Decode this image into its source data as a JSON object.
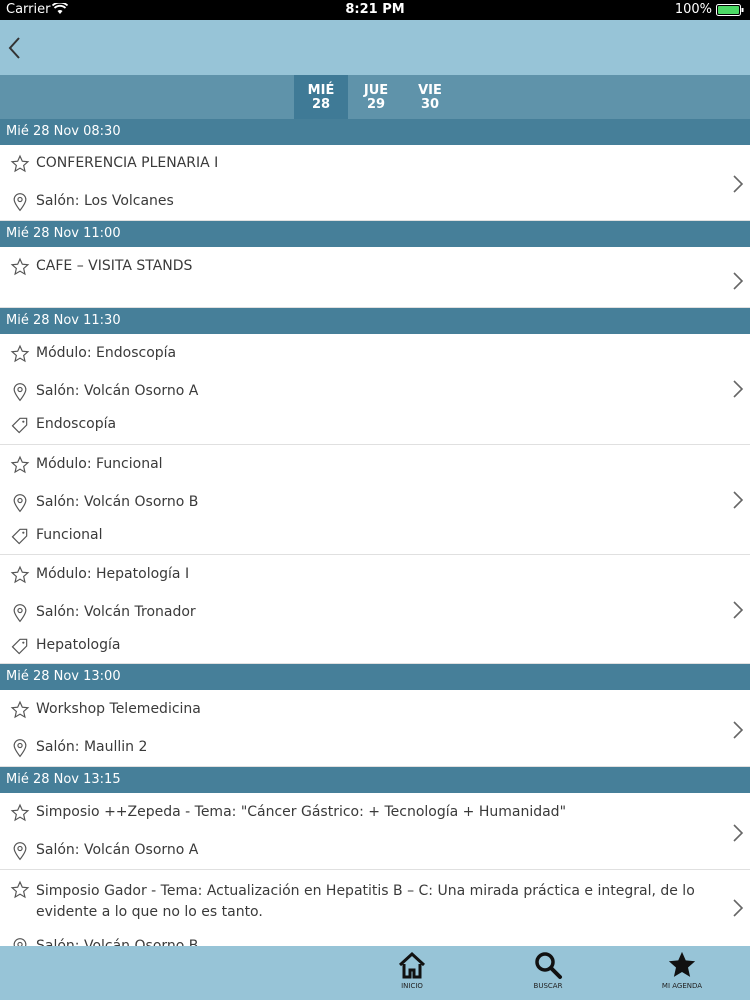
{
  "status_bar": {
    "carrier": "Carrier",
    "time": "8:21 PM",
    "battery": "100%"
  },
  "days": [
    {
      "name": "MIÉ",
      "num": "28",
      "active": true
    },
    {
      "name": "JUE",
      "num": "29",
      "active": false
    },
    {
      "name": "VIE",
      "num": "30",
      "active": false
    }
  ],
  "sections": [
    {
      "header": "Mié 28 Nov 08:30",
      "items": [
        {
          "title": "CONFERENCIA PLENARIA I",
          "room": "Salón: Los Volcanes"
        }
      ]
    },
    {
      "header": "Mié 28 Nov 11:00",
      "items": [
        {
          "title": "CAFE – VISITA STANDS"
        }
      ]
    },
    {
      "header": "Mié 28 Nov 11:30",
      "items": [
        {
          "title": "Módulo: Endoscopía",
          "room": "Salón: Volcán Osorno A",
          "tag": "Endoscopía"
        },
        {
          "title": "Módulo: Funcional",
          "room": "Salón: Volcán Osorno B",
          "tag": "Funcional"
        },
        {
          "title": "Módulo: Hepatología I",
          "room": "Salón: Volcán Tronador",
          "tag": "Hepatología"
        }
      ]
    },
    {
      "header": "Mié 28 Nov 13:00",
      "items": [
        {
          "title": "Workshop Telemedicina",
          "room": "Salón: Maullin 2"
        }
      ]
    },
    {
      "header": "Mié 28 Nov 13:15",
      "items": [
        {
          "title": "Simposio ++Zepeda - Tema: \"Cáncer Gástrico: + Tecnología + Humanidad\"",
          "room": "Salón: Volcán Osorno A"
        },
        {
          "title": "Simposio Gador - Tema: Actualización en Hepatitis B – C: Una mirada práctica e integral, de lo evidente a lo que no lo es tanto.",
          "room": "Salón: Volcán Osorno B"
        }
      ]
    }
  ],
  "tabs": [
    {
      "label": "INICIO",
      "icon": "home-icon"
    },
    {
      "label": "BUSCAR",
      "icon": "search-icon"
    },
    {
      "label": "MI AGENDA",
      "icon": "star-icon"
    }
  ],
  "colors": {
    "nav": "#97c4d7",
    "day_bar": "#5f93aa",
    "day_active": "#3f7a96",
    "section": "#467f99"
  }
}
